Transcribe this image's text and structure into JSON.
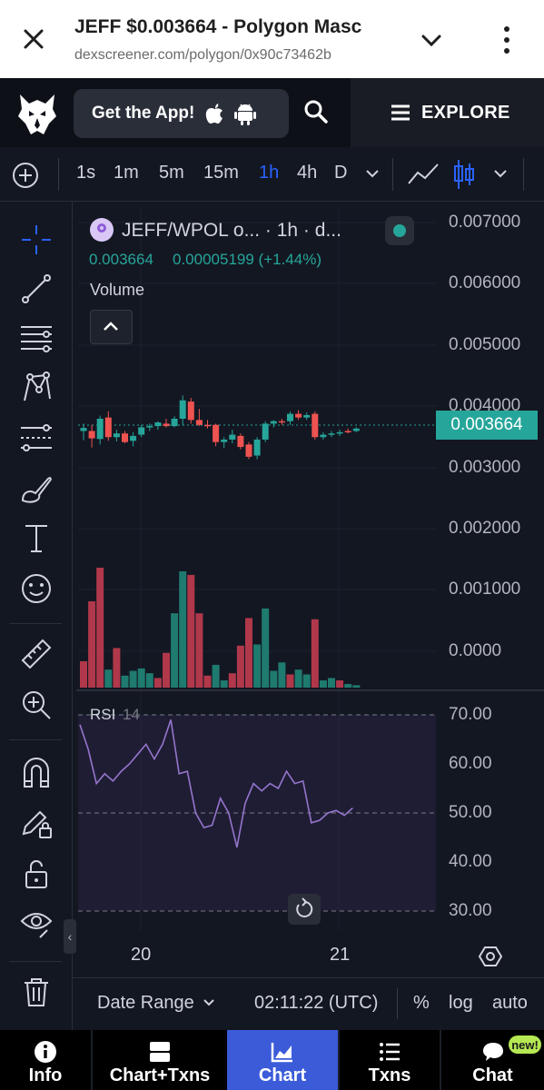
{
  "browser": {
    "title": "JEFF $0.003664 - Polygon Masc",
    "url": "dexscreener.com/polygon/0x90c73462b"
  },
  "header": {
    "get_app_label": "Get the App!",
    "explore_label": "EXPLORE"
  },
  "toolbar": {
    "timeframes": [
      "1s",
      "1m",
      "5m",
      "15m",
      "1h",
      "4h",
      "D"
    ],
    "active_timeframe": "1h"
  },
  "legend": {
    "pair": "JEFF/WPOL o... · 1h · d...",
    "price": "0.003664",
    "change": "0.00005199 (+1.44%)",
    "volume_label": "Volume"
  },
  "price_axis": [
    "0.007000",
    "0.006000",
    "0.005000",
    "0.004000",
    "0.003000",
    "0.002000",
    "0.001000",
    "0.0000"
  ],
  "current_price_tag": "0.003664",
  "rsi": {
    "title": "RSI",
    "length": "14",
    "axis": [
      "70.00",
      "60.00",
      "50.00",
      "40.00",
      "30.00"
    ]
  },
  "x_axis": [
    "20",
    "21"
  ],
  "bottom_bar": {
    "date_range": "Date Range",
    "time": "02:11:22 (UTC)",
    "percent": "%",
    "log": "log",
    "auto": "auto"
  },
  "nav": {
    "items": [
      "Info",
      "Chart+Txns",
      "Chart",
      "Txns",
      "Chat"
    ],
    "active": "Chart",
    "badge": "new!"
  },
  "colors": {
    "up": "#26a69a",
    "down": "#ef5350",
    "rsi_line": "#9575cd",
    "accent": "#2962ff",
    "nav_active": "#3b5bd9"
  },
  "chart_data": {
    "type": "candlestick",
    "timeframe": "1h",
    "x_ticks": [
      "20",
      "21"
    ],
    "ylim": [
      0,
      0.007
    ],
    "candles": [
      {
        "o": 0.00365,
        "h": 0.00372,
        "l": 0.00345,
        "c": 0.0036,
        "up": true
      },
      {
        "o": 0.0036,
        "h": 0.0037,
        "l": 0.00333,
        "c": 0.00348,
        "up": false
      },
      {
        "o": 0.00347,
        "h": 0.00385,
        "l": 0.00338,
        "c": 0.0038,
        "up": true
      },
      {
        "o": 0.00382,
        "h": 0.00392,
        "l": 0.00344,
        "c": 0.0035,
        "up": false
      },
      {
        "o": 0.0035,
        "h": 0.00362,
        "l": 0.00343,
        "c": 0.00356,
        "up": true
      },
      {
        "o": 0.00356,
        "h": 0.0036,
        "l": 0.0034,
        "c": 0.00342,
        "up": false
      },
      {
        "o": 0.00344,
        "h": 0.00358,
        "l": 0.00335,
        "c": 0.00352,
        "up": true
      },
      {
        "o": 0.00354,
        "h": 0.0037,
        "l": 0.0035,
        "c": 0.00366,
        "up": true
      },
      {
        "o": 0.00366,
        "h": 0.00372,
        "l": 0.0036,
        "c": 0.00368,
        "up": true
      },
      {
        "o": 0.00368,
        "h": 0.00376,
        "l": 0.00362,
        "c": 0.00374,
        "up": true
      },
      {
        "o": 0.00372,
        "h": 0.0038,
        "l": 0.00366,
        "c": 0.00368,
        "up": false
      },
      {
        "o": 0.00368,
        "h": 0.00384,
        "l": 0.00366,
        "c": 0.0038,
        "up": true
      },
      {
        "o": 0.0038,
        "h": 0.00418,
        "l": 0.0037,
        "c": 0.0041,
        "up": true
      },
      {
        "o": 0.00408,
        "h": 0.00414,
        "l": 0.00372,
        "c": 0.00378,
        "up": false
      },
      {
        "o": 0.00378,
        "h": 0.00396,
        "l": 0.00368,
        "c": 0.0037,
        "up": false
      },
      {
        "o": 0.0037,
        "h": 0.00378,
        "l": 0.00364,
        "c": 0.00368,
        "up": false
      },
      {
        "o": 0.0037,
        "h": 0.00372,
        "l": 0.00335,
        "c": 0.00342,
        "up": false
      },
      {
        "o": 0.00342,
        "h": 0.0035,
        "l": 0.00332,
        "c": 0.00346,
        "up": true
      },
      {
        "o": 0.00346,
        "h": 0.00362,
        "l": 0.0034,
        "c": 0.00354,
        "up": true
      },
      {
        "o": 0.00352,
        "h": 0.00356,
        "l": 0.0033,
        "c": 0.00334,
        "up": false
      },
      {
        "o": 0.00338,
        "h": 0.00342,
        "l": 0.00314,
        "c": 0.00318,
        "up": false
      },
      {
        "o": 0.0032,
        "h": 0.0035,
        "l": 0.00314,
        "c": 0.00346,
        "up": true
      },
      {
        "o": 0.00346,
        "h": 0.00376,
        "l": 0.00342,
        "c": 0.00372,
        "up": true
      },
      {
        "o": 0.00372,
        "h": 0.00378,
        "l": 0.00366,
        "c": 0.00376,
        "up": true
      },
      {
        "o": 0.00376,
        "h": 0.0038,
        "l": 0.0037,
        "c": 0.00374,
        "up": false
      },
      {
        "o": 0.00376,
        "h": 0.00392,
        "l": 0.0037,
        "c": 0.00388,
        "up": true
      },
      {
        "o": 0.00388,
        "h": 0.00394,
        "l": 0.00378,
        "c": 0.00382,
        "up": false
      },
      {
        "o": 0.00382,
        "h": 0.0039,
        "l": 0.00378,
        "c": 0.00386,
        "up": true
      },
      {
        "o": 0.00388,
        "h": 0.00392,
        "l": 0.00346,
        "c": 0.0035,
        "up": false
      },
      {
        "o": 0.0035,
        "h": 0.00358,
        "l": 0.00346,
        "c": 0.00354,
        "up": true
      },
      {
        "o": 0.00354,
        "h": 0.0036,
        "l": 0.0035,
        "c": 0.00356,
        "up": true
      },
      {
        "o": 0.00356,
        "h": 0.00362,
        "l": 0.00352,
        "c": 0.00358,
        "up": true
      },
      {
        "o": 0.00358,
        "h": 0.00364,
        "l": 0.00356,
        "c": 0.0036,
        "up": false
      },
      {
        "o": 0.0036,
        "h": 0.00366,
        "l": 0.00358,
        "c": 0.00364,
        "up": true
      }
    ],
    "volume_relative": [
      0.22,
      0.72,
      1.0,
      0.15,
      0.33,
      0.1,
      0.14,
      0.16,
      0.12,
      0.08,
      0.29,
      0.62,
      0.97,
      0.94,
      0.62,
      0.1,
      0.19,
      0.06,
      0.12,
      0.35,
      0.58,
      0.36,
      0.66,
      0.14,
      0.21,
      0.11,
      0.15,
      0.11,
      0.57,
      0.06,
      0.08,
      0.06,
      0.03,
      0.02
    ],
    "volume_up": [
      false,
      false,
      false,
      true,
      false,
      true,
      true,
      true,
      true,
      false,
      false,
      true,
      true,
      false,
      false,
      false,
      true,
      true,
      false,
      false,
      false,
      true,
      true,
      true,
      true,
      false,
      true,
      true,
      false,
      true,
      true,
      false,
      true,
      true
    ],
    "rsi_values": [
      68,
      63,
      56,
      58,
      56.5,
      58.5,
      60,
      62,
      64,
      61,
      64,
      69,
      58,
      58.5,
      50,
      47,
      47.5,
      53,
      50,
      43,
      52,
      56,
      54.5,
      56,
      55,
      58.5,
      56,
      56.5,
      48,
      48.5,
      50,
      50.5,
      49.5,
      51
    ],
    "rsi_ylim": [
      30,
      70
    ]
  }
}
